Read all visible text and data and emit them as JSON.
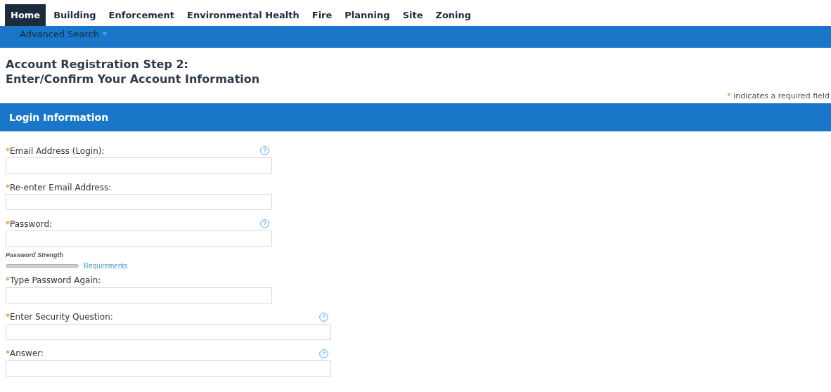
{
  "tabs": [
    {
      "label": "Home",
      "selected": true
    },
    {
      "label": "Building",
      "selected": false
    },
    {
      "label": "Enforcement",
      "selected": false
    },
    {
      "label": "Environmental Health",
      "selected": false
    },
    {
      "label": "Fire",
      "selected": false
    },
    {
      "label": "Planning",
      "selected": false
    },
    {
      "label": "Site",
      "selected": false
    },
    {
      "label": "Zoning",
      "selected": false
    }
  ],
  "subnav": {
    "label": "Advanced Search"
  },
  "heading": [
    "Account Registration Step 2:",
    "Enter/Confirm Your Account Information"
  ],
  "required_note": {
    "marker": "*",
    "text": "indicates a required field"
  },
  "section": {
    "title": "Login Information"
  },
  "login_fields": [
    {
      "kind": "field",
      "label": "Email Address (Login):",
      "marker": "*",
      "help": true
    },
    {
      "kind": "field",
      "label": "Re-enter Email Address:",
      "marker": "*",
      "help": false
    },
    {
      "kind": "field",
      "label": "Password:",
      "marker": "*",
      "help": true
    },
    {
      "kind": "strength",
      "label": "Password Strength",
      "level": 0,
      "link": "Requirements"
    },
    {
      "kind": "field",
      "label": "Type Password Again:",
      "marker": "*",
      "help": false
    }
  ],
  "security_fields": [
    {
      "kind": "field",
      "label": "Enter Security Question:",
      "marker": "*",
      "help": true
    },
    {
      "kind": "field",
      "label": "Answer:",
      "marker": "*",
      "help": true
    }
  ]
}
